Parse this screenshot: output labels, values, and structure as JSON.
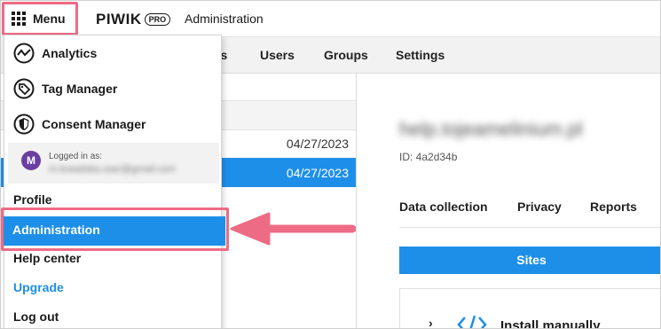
{
  "header": {
    "menu_label": "Menu",
    "logo_main": "PIWIK",
    "logo_pro": "PRO",
    "app_title": "Administration"
  },
  "nav": {
    "items": [
      {
        "label": "ps"
      },
      {
        "label": "Users"
      },
      {
        "label": "Groups"
      },
      {
        "label": "Settings"
      }
    ]
  },
  "list": {
    "rows": [
      {
        "date": "04/27/2023",
        "selected": false
      },
      {
        "date": "04/27/2023",
        "selected": true
      }
    ]
  },
  "detail": {
    "site_name": "help.tojeamelinium.pl",
    "site_id": "ID: 4a2d34b",
    "tabs": [
      {
        "label": "Data collection"
      },
      {
        "label": "Privacy"
      },
      {
        "label": "Reports"
      }
    ],
    "sites_label": "Sites",
    "install_label": "Install manually"
  },
  "menu": {
    "apps": [
      {
        "label": "Analytics",
        "icon": "analytics-icon"
      },
      {
        "label": "Tag Manager",
        "icon": "tag-icon"
      },
      {
        "label": "Consent Manager",
        "icon": "shield-icon"
      }
    ],
    "user": {
      "avatar_letter": "M",
      "logged_label": "Logged in as:",
      "email": "m.kowalska.user@gmail.com"
    },
    "links": {
      "profile": "Profile",
      "administration": "Administration",
      "help": "Help center",
      "upgrade": "Upgrade",
      "logout": "Log out"
    }
  },
  "colors": {
    "accent": "#1e8fe9",
    "highlight": "#ee6b85",
    "avatar": "#6b3fa0"
  }
}
